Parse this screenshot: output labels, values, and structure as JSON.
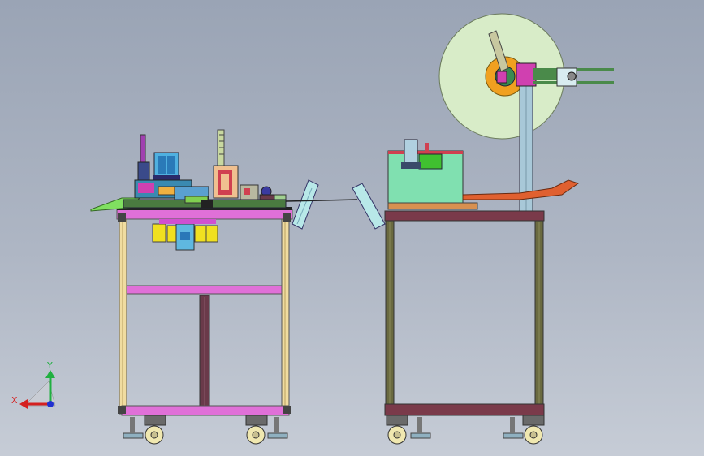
{
  "scene": {
    "background_top": "#9aa4b5",
    "background_bottom": "#c6ccd6"
  },
  "triad": {
    "x_label": "X",
    "y_label": "Y",
    "x_color": "#d42020",
    "y_color": "#20b040",
    "z_color": "#2030d0"
  },
  "left_machine": {
    "frame_color": "#f0dca0",
    "crossbar_color": "#e070d8",
    "center_post_color": "#6a3a4a"
  },
  "right_machine": {
    "frame_color": "#6a6a40",
    "crossbar_color": "#7a3a4a",
    "hopper_color": "#80e0b0",
    "reel_color": "#d8ecc8",
    "hub_color": "#f0a020"
  }
}
